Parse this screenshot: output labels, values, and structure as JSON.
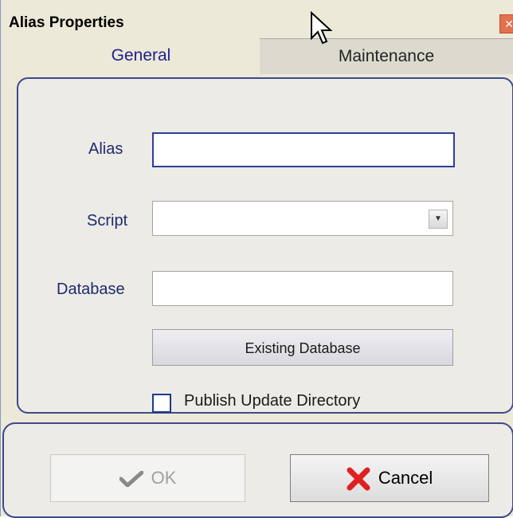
{
  "window": {
    "title": "Alias Properties"
  },
  "tabs": [
    {
      "label": "General"
    },
    {
      "label": "Maintenance"
    }
  ],
  "form": {
    "alias_label": "Alias",
    "alias_value": "",
    "script_label": "Script",
    "script_value": "",
    "database_label": "Database",
    "database_value": "",
    "existing_db_button": "Existing Database",
    "publish_label": "Publish Update Directory",
    "publish_checked": false
  },
  "footer": {
    "ok_label": "OK",
    "cancel_label": "Cancel"
  },
  "icons": {
    "close": "close-icon",
    "dropdown": "chevron-down-icon",
    "ok": "checkmark-icon",
    "cancel": "x-icon"
  }
}
